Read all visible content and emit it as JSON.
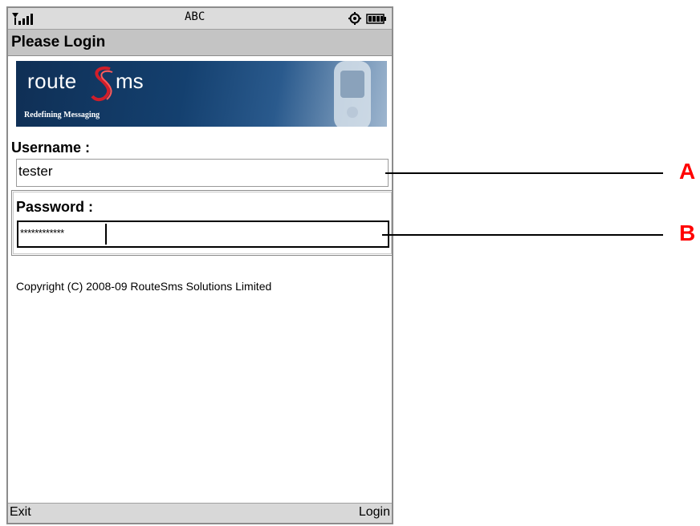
{
  "status_bar": {
    "network": "ABC",
    "icons": [
      "signal-icon",
      "gear-icon",
      "battery-icon"
    ]
  },
  "title_bar": {
    "title": "Please Login"
  },
  "banner": {
    "logo_route": "route",
    "logo_ms": "ms",
    "tagline": "Redefining Messaging"
  },
  "form": {
    "username_label": "Username :",
    "username_value": "tester",
    "password_label": "Password :",
    "password_value": "************"
  },
  "footer_text": "Copyright (C) 2008-09 RouteSms Solutions Limited",
  "soft_keys": {
    "left": "Exit",
    "right": "Login"
  },
  "callouts": [
    "A",
    "B"
  ],
  "colors": {
    "callout": "#ff0000",
    "banner": "#14406f"
  }
}
